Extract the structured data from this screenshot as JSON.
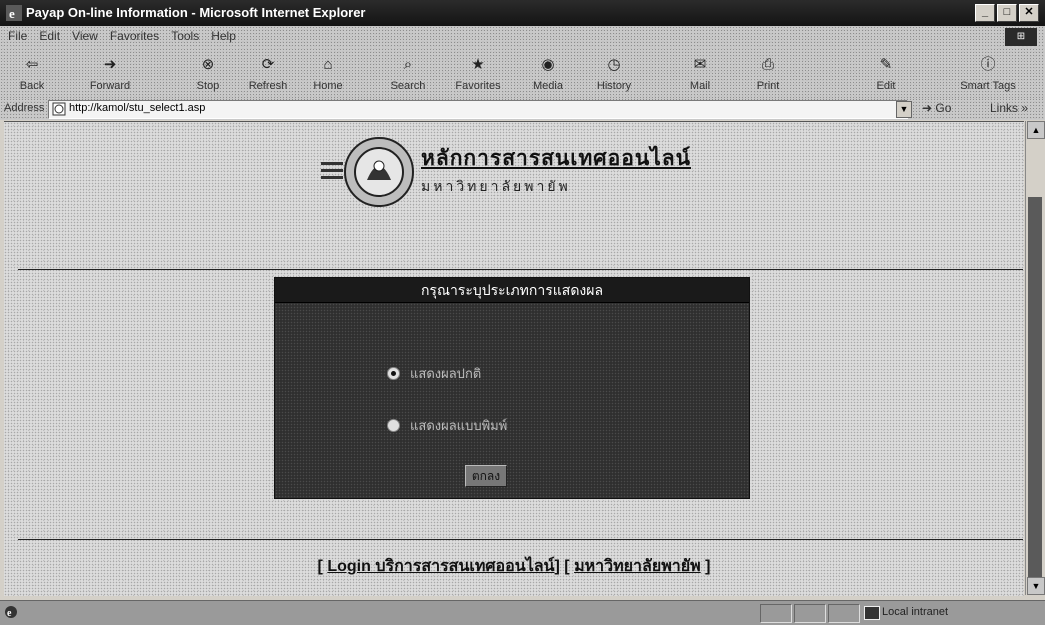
{
  "window": {
    "title": "Payap On-line Information - Microsoft Internet Explorer",
    "buttons": {
      "minimize": "_",
      "maximize": "□",
      "close": "✕"
    }
  },
  "menubar": {
    "items": [
      "File",
      "Edit",
      "View",
      "Favorites",
      "Tools",
      "Help"
    ]
  },
  "toolbar": {
    "back": "Back",
    "forward": "Forward",
    "stop": "Stop",
    "refresh": "Refresh",
    "home": "Home",
    "search": "Search",
    "favorites": "Favorites",
    "media": "Media",
    "history": "History",
    "mail": "Mail",
    "print": "Print",
    "edit": "Edit",
    "smarttags": "Smart Tags"
  },
  "address": {
    "label": "Address",
    "url": "http://kamol/stu_select1.asp",
    "go": "Go",
    "links": "Links »"
  },
  "page": {
    "logo_title": "หลักการสารสนเทศออนไลน์",
    "logo_subtitle": "มหาวิทยาลัยพายัพ",
    "panel_title": "กรุณาระบุประเภทการแสดงผล",
    "options": [
      {
        "label": "แสดงผลปกติ",
        "checked": true
      },
      {
        "label": "แสดงผลแบบพิมพ์",
        "checked": false
      }
    ],
    "submit_label": "ตกลง",
    "footer": {
      "open_bracket": "[",
      "link1": "Login บริการสารสนเทศออนไลน์",
      "middle": "] [",
      "link2": "มหาวิทยาลัยพายัพ",
      "close_bracket": "]"
    }
  },
  "statusbar": {
    "zone": "Local intranet"
  }
}
